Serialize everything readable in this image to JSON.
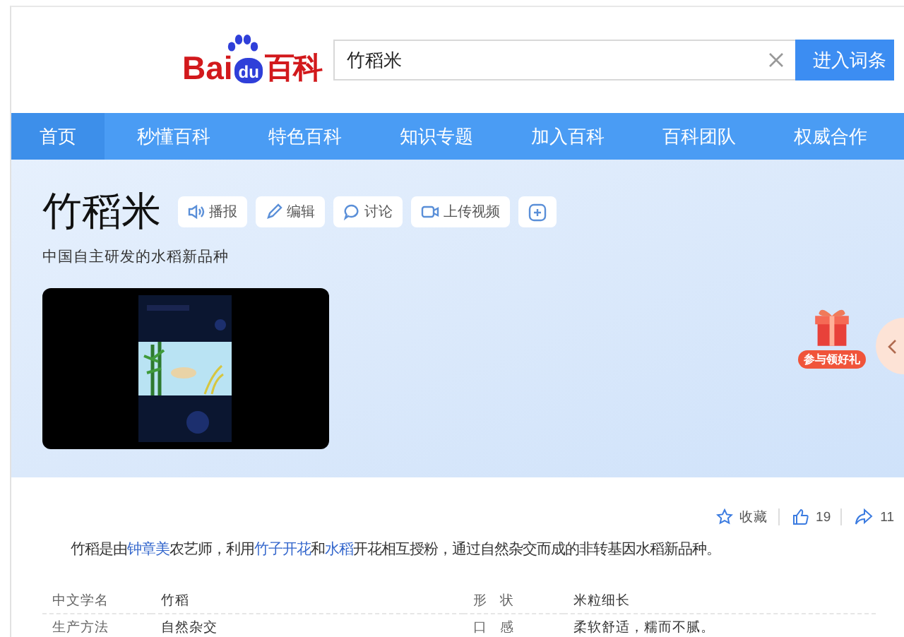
{
  "logo": {
    "left": "Bai",
    "mark": "du",
    "right": "百科"
  },
  "search": {
    "value": "竹稻米",
    "button": "进入词条"
  },
  "nav": [
    {
      "label": "首页",
      "selected": true
    },
    {
      "label": "秒懂百科",
      "selected": false
    },
    {
      "label": "特色百科",
      "selected": false
    },
    {
      "label": "知识专题",
      "selected": false
    },
    {
      "label": "加入百科",
      "selected": false
    },
    {
      "label": "百科团队",
      "selected": false
    },
    {
      "label": "权威合作",
      "selected": false
    }
  ],
  "entry": {
    "title": "竹稻米",
    "subtitle": "中国自主研发的水稻新品种",
    "tools": [
      {
        "kind": "speaker",
        "label": "播报"
      },
      {
        "kind": "edit",
        "label": "编辑"
      },
      {
        "kind": "comment",
        "label": "讨论"
      },
      {
        "kind": "video",
        "label": "上传视频"
      },
      {
        "kind": "add"
      }
    ],
    "gift": {
      "label": "参与领好礼"
    }
  },
  "stats": [
    {
      "kind": "star",
      "label": "收藏"
    },
    {
      "kind": "like",
      "label": "19"
    },
    {
      "kind": "share",
      "label": "11"
    }
  ],
  "summary": [
    {
      "text": "竹稻是由",
      "link": false
    },
    {
      "text": "钟章美",
      "link": true
    },
    {
      "text": "农艺师，利用",
      "link": false
    },
    {
      "text": "竹子开花",
      "link": true
    },
    {
      "text": "和",
      "link": false
    },
    {
      "text": "水稻",
      "link": true
    },
    {
      "text": "开花相互授粉，通过自然杂交而成的非转基因水稻新品种。",
      "link": false
    }
  ],
  "info": [
    {
      "label": "中文学名",
      "value": "竹稻"
    },
    {
      "label": "形 状",
      "value": "米粒细长"
    },
    {
      "label": "生产方法",
      "value": "自然杂交"
    },
    {
      "label": "口 感",
      "value": "柔软舒适，糯而不腻。"
    }
  ]
}
